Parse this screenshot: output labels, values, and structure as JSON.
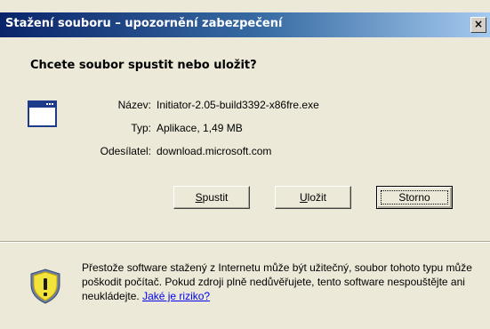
{
  "window": {
    "title": "Stažení souboru – upozornění zabezpečení",
    "close_glyph": "×"
  },
  "dialog": {
    "question": "Chcete soubor spustit nebo uložit?",
    "file_icon": "application-window-icon",
    "fields": [
      {
        "label": "Název:",
        "value": "Initiator-2.05-build3392-x86fre.exe"
      },
      {
        "label": "Typ:",
        "value": "Aplikace, 1,49 MB"
      },
      {
        "label": "Odesílatel:",
        "value": "download.microsoft.com"
      }
    ],
    "buttons": {
      "run": {
        "mnemonic": "S",
        "rest": "pustit"
      },
      "save": {
        "mnemonic": "U",
        "rest": "ložit"
      },
      "cancel": {
        "label": "Storno"
      }
    }
  },
  "warning": {
    "icon": "shield-warning-icon",
    "text": "Přestože software stažený z Internetu může být užitečný, soubor tohoto typu může poškodit počítač. Pokud zdroji plně nedůvěřujete, tento software nespouštějte ani neukládejte.",
    "link": "Jaké je riziko?"
  },
  "colors": {
    "titlebar_start": "#0a246a",
    "titlebar_end": "#a6caf0",
    "dialog_bg": "#ece9d8",
    "link": "#0000ee"
  }
}
